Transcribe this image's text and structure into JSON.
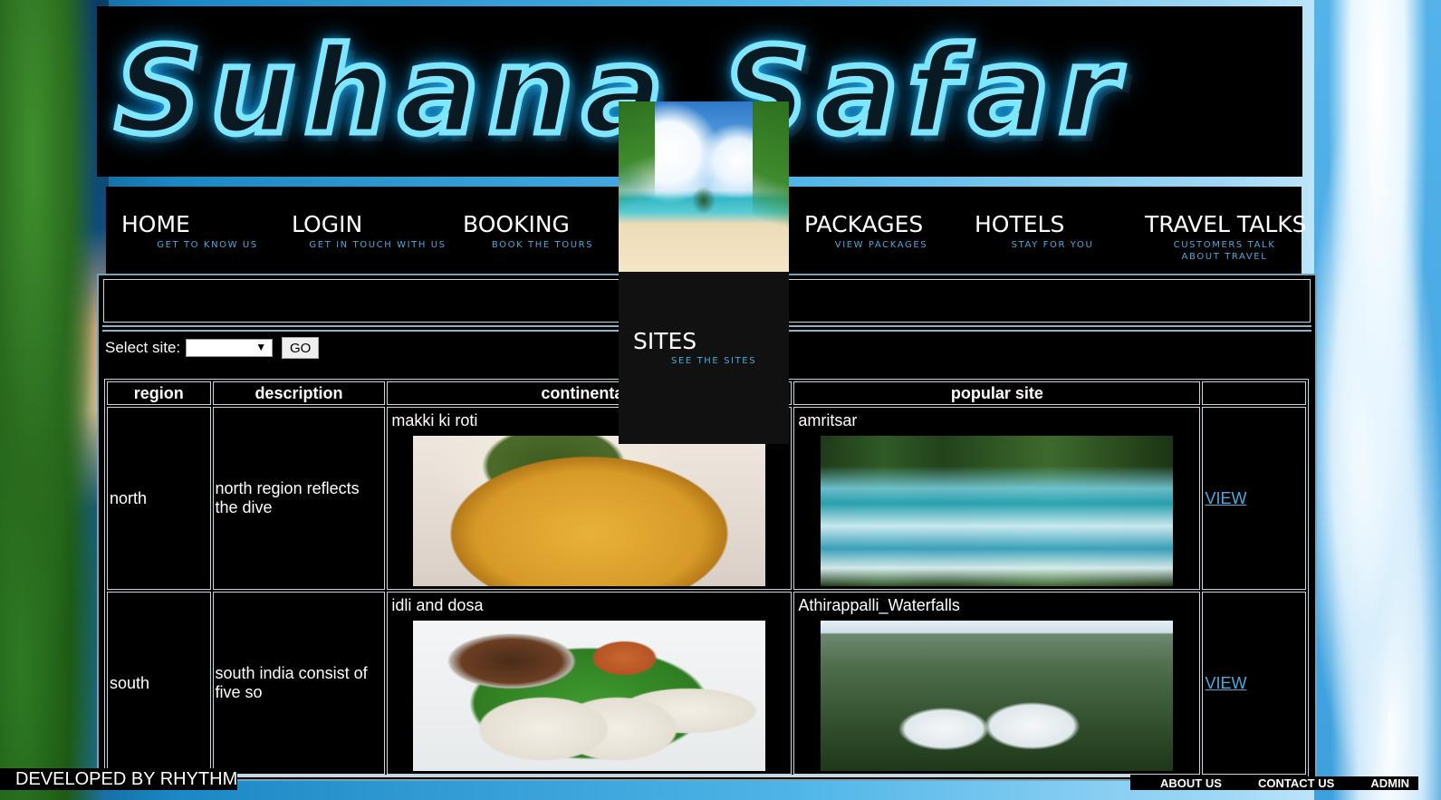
{
  "banner": {
    "title": "Suhana Safar"
  },
  "nav": {
    "items": [
      {
        "label": "HOME",
        "sub": "GET TO KNOW US"
      },
      {
        "label": "LOGIN",
        "sub": "GET IN TOUCH WITH US"
      },
      {
        "label": "BOOKING",
        "sub": "BOOK THE TOURS"
      },
      {
        "label": "PACKAGES",
        "sub": "VIEW PACKAGES"
      },
      {
        "label": "HOTELS",
        "sub": "STAY FOR YOU"
      },
      {
        "label": "TRAVEL TALKS",
        "sub": "CUSTOMERS TALK ABOUT TRAVEL"
      }
    ],
    "dropdown": {
      "label": "SITES",
      "sub": "SEE THE SITES"
    }
  },
  "filter": {
    "label": "Select site:",
    "selected": "",
    "go_label": "GO"
  },
  "table": {
    "headers": [
      "region",
      "description",
      "continental f",
      "popular site",
      ""
    ],
    "rows": [
      {
        "region": "north",
        "description": "north region reflects the dive",
        "food": "makki ki roti",
        "site": "amritsar",
        "action": "VIEW"
      },
      {
        "region": "south",
        "description": "south india consist of five so",
        "food": "idli and dosa",
        "site": "Athirappalli_Waterfalls",
        "action": "VIEW"
      }
    ]
  },
  "footer": {
    "developer": "DEVELOPED BY RHYTHM",
    "links": [
      "ABOUT US",
      "CONTACT US",
      "ADMIN"
    ]
  },
  "colors": {
    "accent": "#4aa9dd",
    "neon": "#7fe6ff",
    "panel": "#000000"
  }
}
